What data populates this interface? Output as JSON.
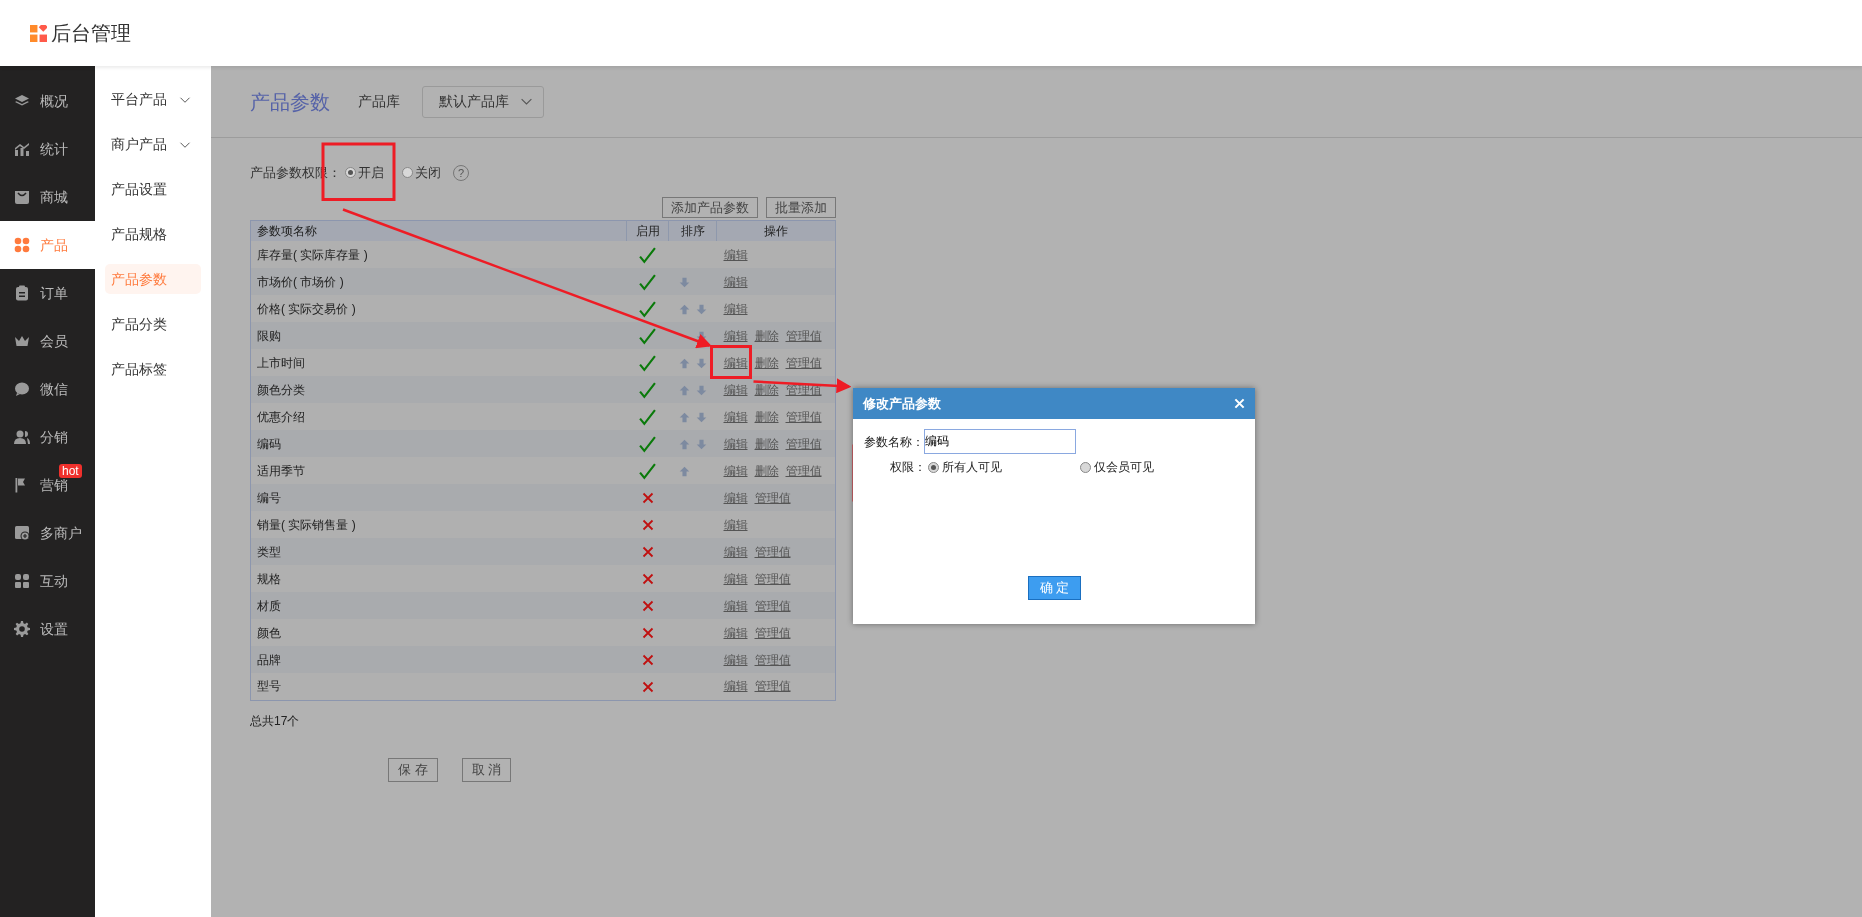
{
  "header": {
    "title": "后台管理"
  },
  "nav": {
    "items": [
      {
        "label": "概况",
        "selected": false
      },
      {
        "label": "统计",
        "selected": false
      },
      {
        "label": "商城",
        "selected": false
      },
      {
        "label": "产品",
        "selected": true
      },
      {
        "label": "订单",
        "selected": false
      },
      {
        "label": "会员",
        "selected": false
      },
      {
        "label": "微信",
        "selected": false
      },
      {
        "label": "分销",
        "selected": false
      },
      {
        "label": "营销",
        "selected": false,
        "badge": "hot"
      },
      {
        "label": "多商户",
        "selected": false
      },
      {
        "label": "互动",
        "selected": false
      },
      {
        "label": "设置",
        "selected": false
      }
    ]
  },
  "subnav": {
    "items": [
      {
        "label": "平台产品",
        "expandable": true,
        "selected": false
      },
      {
        "label": "商户产品",
        "expandable": true,
        "selected": false
      },
      {
        "label": "产品设置",
        "expandable": false,
        "selected": false
      },
      {
        "label": "产品规格",
        "expandable": false,
        "selected": false
      },
      {
        "label": "产品参数",
        "expandable": false,
        "selected": true
      },
      {
        "label": "产品分类",
        "expandable": false,
        "selected": false
      },
      {
        "label": "产品标签",
        "expandable": false,
        "selected": false
      }
    ]
  },
  "page": {
    "title": "产品参数",
    "library_label": "产品库",
    "library_value": "默认产品库",
    "permission": {
      "label": "产品参数权限：",
      "options": [
        {
          "label": "开启",
          "selected": true
        },
        {
          "label": "关闭",
          "selected": false
        }
      ],
      "help": "?"
    },
    "toolbar": [
      "添加产品参数",
      "批量添加"
    ],
    "table": {
      "columns": [
        "参数项名称",
        "启用",
        "排序",
        "操作"
      ],
      "rows": [
        {
          "name": "库存量( 实际库存量 )",
          "enabled": true,
          "sort_up": false,
          "sort_down": false,
          "actions": [
            "编辑"
          ]
        },
        {
          "name": "市场价( 市场价 )",
          "enabled": true,
          "sort_up": false,
          "sort_down": true,
          "actions": [
            "编辑"
          ]
        },
        {
          "name": "价格( 实际交易价 )",
          "enabled": true,
          "sort_up": true,
          "sort_down": true,
          "actions": [
            "编辑"
          ]
        },
        {
          "name": "限购",
          "enabled": true,
          "sort_up": false,
          "sort_down": true,
          "actions": [
            "编辑",
            "删除",
            "管理值"
          ]
        },
        {
          "name": "上市时间",
          "enabled": true,
          "sort_up": true,
          "sort_down": true,
          "actions": [
            "编辑",
            "删除",
            "管理值"
          ]
        },
        {
          "name": "颜色分类",
          "enabled": true,
          "sort_up": true,
          "sort_down": true,
          "actions": [
            "编辑",
            "删除",
            "管理值"
          ]
        },
        {
          "name": "优惠介绍",
          "enabled": true,
          "sort_up": true,
          "sort_down": true,
          "actions": [
            "编辑",
            "删除",
            "管理值"
          ]
        },
        {
          "name": "编码",
          "enabled": true,
          "sort_up": true,
          "sort_down": true,
          "actions": [
            "编辑",
            "删除",
            "管理值"
          ]
        },
        {
          "name": "适用季节",
          "enabled": true,
          "sort_up": true,
          "sort_down": false,
          "actions": [
            "编辑",
            "删除",
            "管理值"
          ]
        },
        {
          "name": "编号",
          "enabled": false,
          "sort_up": false,
          "sort_down": false,
          "actions": [
            "编辑",
            "管理值"
          ]
        },
        {
          "name": "销量( 实际销售量 )",
          "enabled": false,
          "sort_up": false,
          "sort_down": false,
          "actions": [
            "编辑"
          ]
        },
        {
          "name": "类型",
          "enabled": false,
          "sort_up": false,
          "sort_down": false,
          "actions": [
            "编辑",
            "管理值"
          ]
        },
        {
          "name": "规格",
          "enabled": false,
          "sort_up": false,
          "sort_down": false,
          "actions": [
            "编辑",
            "管理值"
          ]
        },
        {
          "name": "材质",
          "enabled": false,
          "sort_up": false,
          "sort_down": false,
          "actions": [
            "编辑",
            "管理值"
          ]
        },
        {
          "name": "颜色",
          "enabled": false,
          "sort_up": false,
          "sort_down": false,
          "actions": [
            "编辑",
            "管理值"
          ]
        },
        {
          "name": "品牌",
          "enabled": false,
          "sort_up": false,
          "sort_down": false,
          "actions": [
            "编辑",
            "管理值"
          ]
        },
        {
          "name": "型号",
          "enabled": false,
          "sort_up": false,
          "sort_down": false,
          "actions": [
            "编辑",
            "管理值"
          ]
        }
      ]
    },
    "total": "总共17个",
    "footer_buttons": [
      "保 存",
      "取 消"
    ]
  },
  "dialog": {
    "title": "修改产品参数",
    "name_label": "参数名称：",
    "name_value": "编码",
    "perm_label": "权限：",
    "options": [
      {
        "label": "所有人可见",
        "selected": true
      },
      {
        "label": "仅会员可见",
        "selected": false
      }
    ],
    "confirm": "确 定"
  }
}
